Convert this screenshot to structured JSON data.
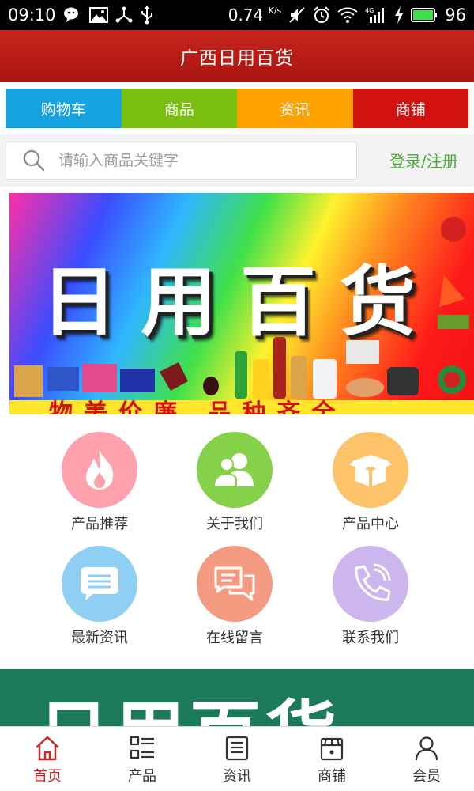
{
  "status_bar": {
    "time": "09:10",
    "speed_value": "0.74",
    "speed_unit": "K/s",
    "network": "4G",
    "battery": "96",
    "icons": [
      "wechat-icon",
      "image-icon",
      "share-icon",
      "usb-icon",
      "mute-icon",
      "alarm-icon",
      "wifi-icon",
      "signal-icon",
      "charging-icon",
      "battery-icon"
    ]
  },
  "header": {
    "title": "广西日用百货"
  },
  "nav_tabs": [
    {
      "label": "购物车",
      "color": "#16a3e2"
    },
    {
      "label": "商品",
      "color": "#7abf0f"
    },
    {
      "label": "资讯",
      "color": "#ffa200"
    },
    {
      "label": "商铺",
      "color": "#d2120f"
    }
  ],
  "search": {
    "placeholder": "请输入商品关键字",
    "value": "",
    "login_label": "登录/注册"
  },
  "banner": {
    "title": "日用百货",
    "slogan": "物美价廉 品种齐全"
  },
  "quick_links": [
    {
      "label": "产品推荐",
      "icon": "flame-icon",
      "color": "#fea1ad"
    },
    {
      "label": "关于我们",
      "icon": "people-icon",
      "color": "#86d14a"
    },
    {
      "label": "产品中心",
      "icon": "box-icon",
      "color": "#fdc36b"
    },
    {
      "label": "最新资讯",
      "icon": "message-icon",
      "color": "#8ecff3"
    },
    {
      "label": "在线留言",
      "icon": "chat-icon",
      "color": "#f39a81"
    },
    {
      "label": "联系我们",
      "icon": "phone-icon",
      "color": "#cdb5ee"
    }
  ],
  "banner2": {
    "text": "日用百货"
  },
  "bottom_nav": [
    {
      "label": "首页",
      "icon": "home-icon",
      "active": true
    },
    {
      "label": "产品",
      "icon": "list-icon",
      "active": false
    },
    {
      "label": "资讯",
      "icon": "news-icon",
      "active": false
    },
    {
      "label": "商铺",
      "icon": "store-icon",
      "active": false
    },
    {
      "label": "会员",
      "icon": "user-icon",
      "active": false
    }
  ],
  "colors": {
    "header_red": "#b81d15",
    "accent_green": "#4aa83a",
    "active_red": "#c8281f"
  }
}
